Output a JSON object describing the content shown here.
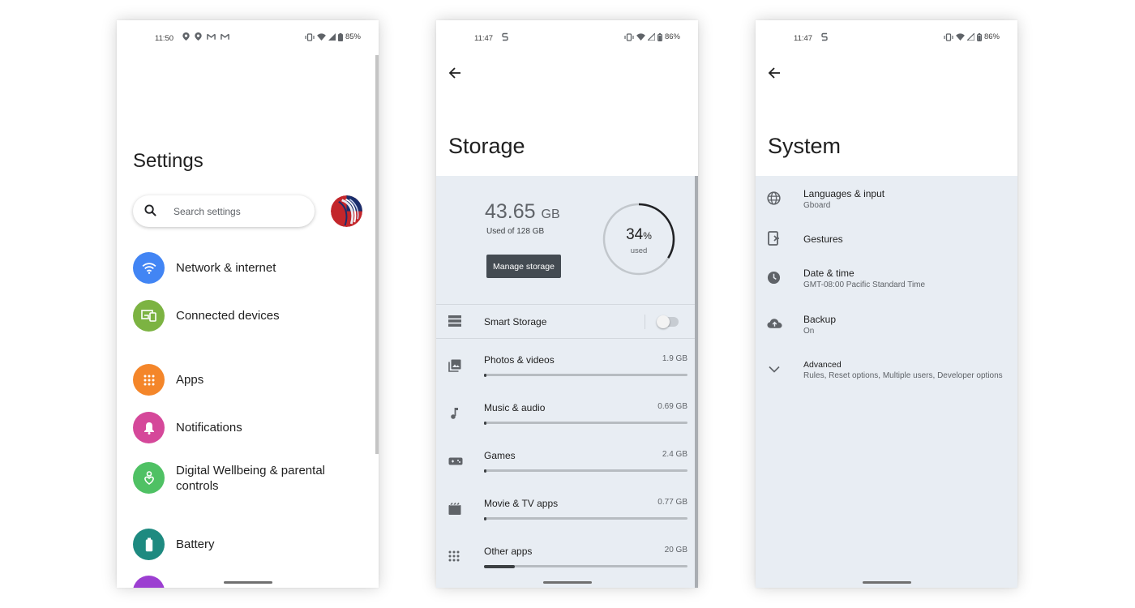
{
  "phone1": {
    "status": {
      "time": "11:50",
      "battery": "85%"
    },
    "title": "Settings",
    "search": {
      "placeholder": "Search settings"
    },
    "items": [
      {
        "label": "Network & internet",
        "color": "#4285f4",
        "icon": "wifi-icon"
      },
      {
        "label": "Connected devices",
        "color": "#7cb342",
        "icon": "devices-icon"
      },
      {
        "label": "Apps",
        "color": "#f4862a",
        "icon": "apps-grid-icon"
      },
      {
        "label": "Notifications",
        "color": "#d5489a",
        "icon": "bell-icon"
      },
      {
        "label": "Digital Wellbeing & parental controls",
        "color": "#4fc164",
        "icon": "wellbeing-heart-icon"
      },
      {
        "label": "Battery",
        "color": "#1e8a80",
        "icon": "battery-icon"
      }
    ]
  },
  "phone2": {
    "status": {
      "time": "11:47",
      "battery": "86%"
    },
    "title": "Storage",
    "summary": {
      "used_value": "43.65",
      "used_unit": "GB",
      "used_of": "Used of 128 GB",
      "percent": "34",
      "percent_sign": "%",
      "percent_label": "used",
      "fraction": 0.34
    },
    "manage_button": "Manage storage",
    "smart_storage": {
      "label": "Smart Storage",
      "enabled": false
    },
    "categories": [
      {
        "label": "Photos & videos",
        "size": "1.9 GB",
        "fraction": 0.01,
        "icon": "photos-icon"
      },
      {
        "label": "Music & audio",
        "size": "0.69 GB",
        "fraction": 0.004,
        "icon": "music-note-icon"
      },
      {
        "label": "Games",
        "size": "2.4 GB",
        "fraction": 0.012,
        "icon": "gamepad-icon"
      },
      {
        "label": "Movie & TV apps",
        "size": "0.77 GB",
        "fraction": 0.004,
        "icon": "movie-clapper-icon"
      },
      {
        "label": "Other apps",
        "size": "20 GB",
        "fraction": 0.15,
        "icon": "apps-grid-icon"
      }
    ]
  },
  "phone3": {
    "status": {
      "time": "11:47",
      "battery": "86%"
    },
    "title": "System",
    "items": [
      {
        "title": "Languages & input",
        "subtitle": "Gboard",
        "icon": "globe-icon"
      },
      {
        "title": "Gestures",
        "subtitle": "",
        "icon": "gestures-phone-icon"
      },
      {
        "title": "Date & time",
        "subtitle": "GMT-08:00 Pacific Standard Time",
        "icon": "clock-icon"
      },
      {
        "title": "Backup",
        "subtitle": "On",
        "icon": "cloud-upload-icon"
      },
      {
        "title": "Advanced",
        "subtitle": "Rules, Reset options, Multiple users, Developer options",
        "icon": "chevron-down-icon"
      }
    ]
  }
}
